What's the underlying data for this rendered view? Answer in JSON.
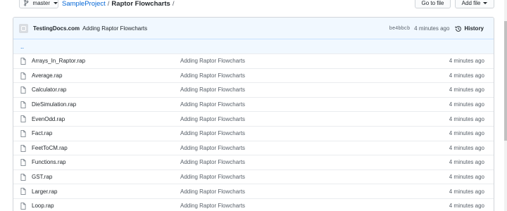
{
  "toolbar": {
    "branch": "master",
    "goto_file": "Go to file",
    "add_file": "Add file"
  },
  "breadcrumb": {
    "repo": "SampleProject",
    "folder": "Raptor Flowcharts",
    "sep": "/"
  },
  "commit": {
    "author": "TestingDocs.com",
    "message": "Adding Raptor Flowcharts",
    "sha": "be4bbcb",
    "time": "4 minutes ago",
    "history_label": "History"
  },
  "up_dir": "..",
  "files": [
    {
      "name": "Arrays_In_Raptor.rap",
      "commit": "Adding Raptor Flowcharts",
      "age": "4 minutes ago"
    },
    {
      "name": "Average.rap",
      "commit": "Adding Raptor Flowcharts",
      "age": "4 minutes ago"
    },
    {
      "name": "Calculator.rap",
      "commit": "Adding Raptor Flowcharts",
      "age": "4 minutes ago"
    },
    {
      "name": "DieSimulation.rap",
      "commit": "Adding Raptor Flowcharts",
      "age": "4 minutes ago"
    },
    {
      "name": "EvenOdd.rap",
      "commit": "Adding Raptor Flowcharts",
      "age": "4 minutes ago"
    },
    {
      "name": "Fact.rap",
      "commit": "Adding Raptor Flowcharts",
      "age": "4 minutes ago"
    },
    {
      "name": "FeetToCM.rap",
      "commit": "Adding Raptor Flowcharts",
      "age": "4 minutes ago"
    },
    {
      "name": "Functions.rap",
      "commit": "Adding Raptor Flowcharts",
      "age": "4 minutes ago"
    },
    {
      "name": "GST.rap",
      "commit": "Adding Raptor Flowcharts",
      "age": "4 minutes ago"
    },
    {
      "name": "Larger.rap",
      "commit": "Adding Raptor Flowcharts",
      "age": "4 minutes ago"
    },
    {
      "name": "Loop.rap",
      "commit": "Adding Raptor Flowcharts",
      "age": "4 minutes ago"
    }
  ],
  "icons": {
    "branch": "git-branch-icon",
    "file": "file-icon",
    "history": "clock-history-icon",
    "caret": "chevron-down-icon"
  },
  "colors": {
    "link": "#0366d6",
    "commit_bar": "#f1f8ff",
    "border": "#d1d5da"
  }
}
